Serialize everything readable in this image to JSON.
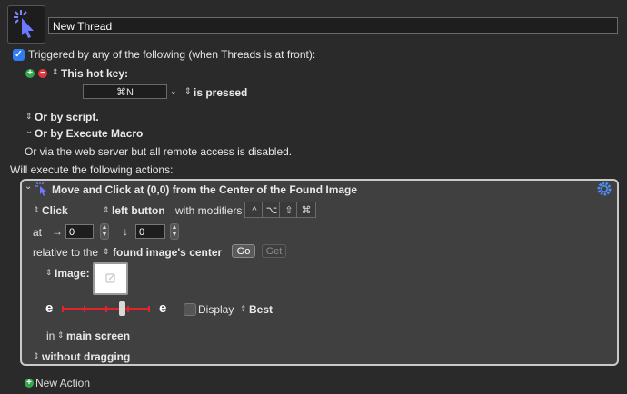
{
  "macro": {
    "name": "New Thread",
    "trigger_label": "Triggered by any of the following (when Threads is at front):",
    "hotkey_trigger_label": "This hot key:",
    "hotkey_value": "⌘N",
    "hotkey_state": "is pressed",
    "or_by_script": "Or by script.",
    "or_by_execute_macro": "Or by Execute Macro",
    "web_server_note": "Or via the web server but all remote access is disabled.",
    "will_execute": "Will execute the following actions:",
    "new_action": "New Action"
  },
  "action": {
    "title": "Move and Click at (0,0) from the Center of the Found Image",
    "click_type": "Click",
    "button": "left button",
    "with_modifiers": "with modifiers",
    "modifiers": [
      "^",
      "⌥",
      "⇧",
      "⌘"
    ],
    "at_label": "at",
    "x_value": "0",
    "y_value": "0",
    "relative_label": "relative to the",
    "relative_option": "found image's center",
    "go_label": "Go",
    "get_label": "Get",
    "image_label": "Image:",
    "fuzz_left": "e",
    "fuzz_right": "e",
    "fuzz_level_fraction": 0.69,
    "display_label": "Display",
    "display_option": "Best",
    "in_label": "in",
    "screen_option": "main screen",
    "drag_option": "without dragging"
  },
  "colors": {
    "accent_blue": "#2e7cf6",
    "add_green": "#31a94c",
    "remove_red": "#e0373a",
    "slider_red": "#e1242b"
  },
  "icons": [
    "click-cursor-icon",
    "gear-icon",
    "plus-icon",
    "minus-icon",
    "chevron-down-icon",
    "updown-icon",
    "arrow-right-icon",
    "arrow-down-icon"
  ]
}
